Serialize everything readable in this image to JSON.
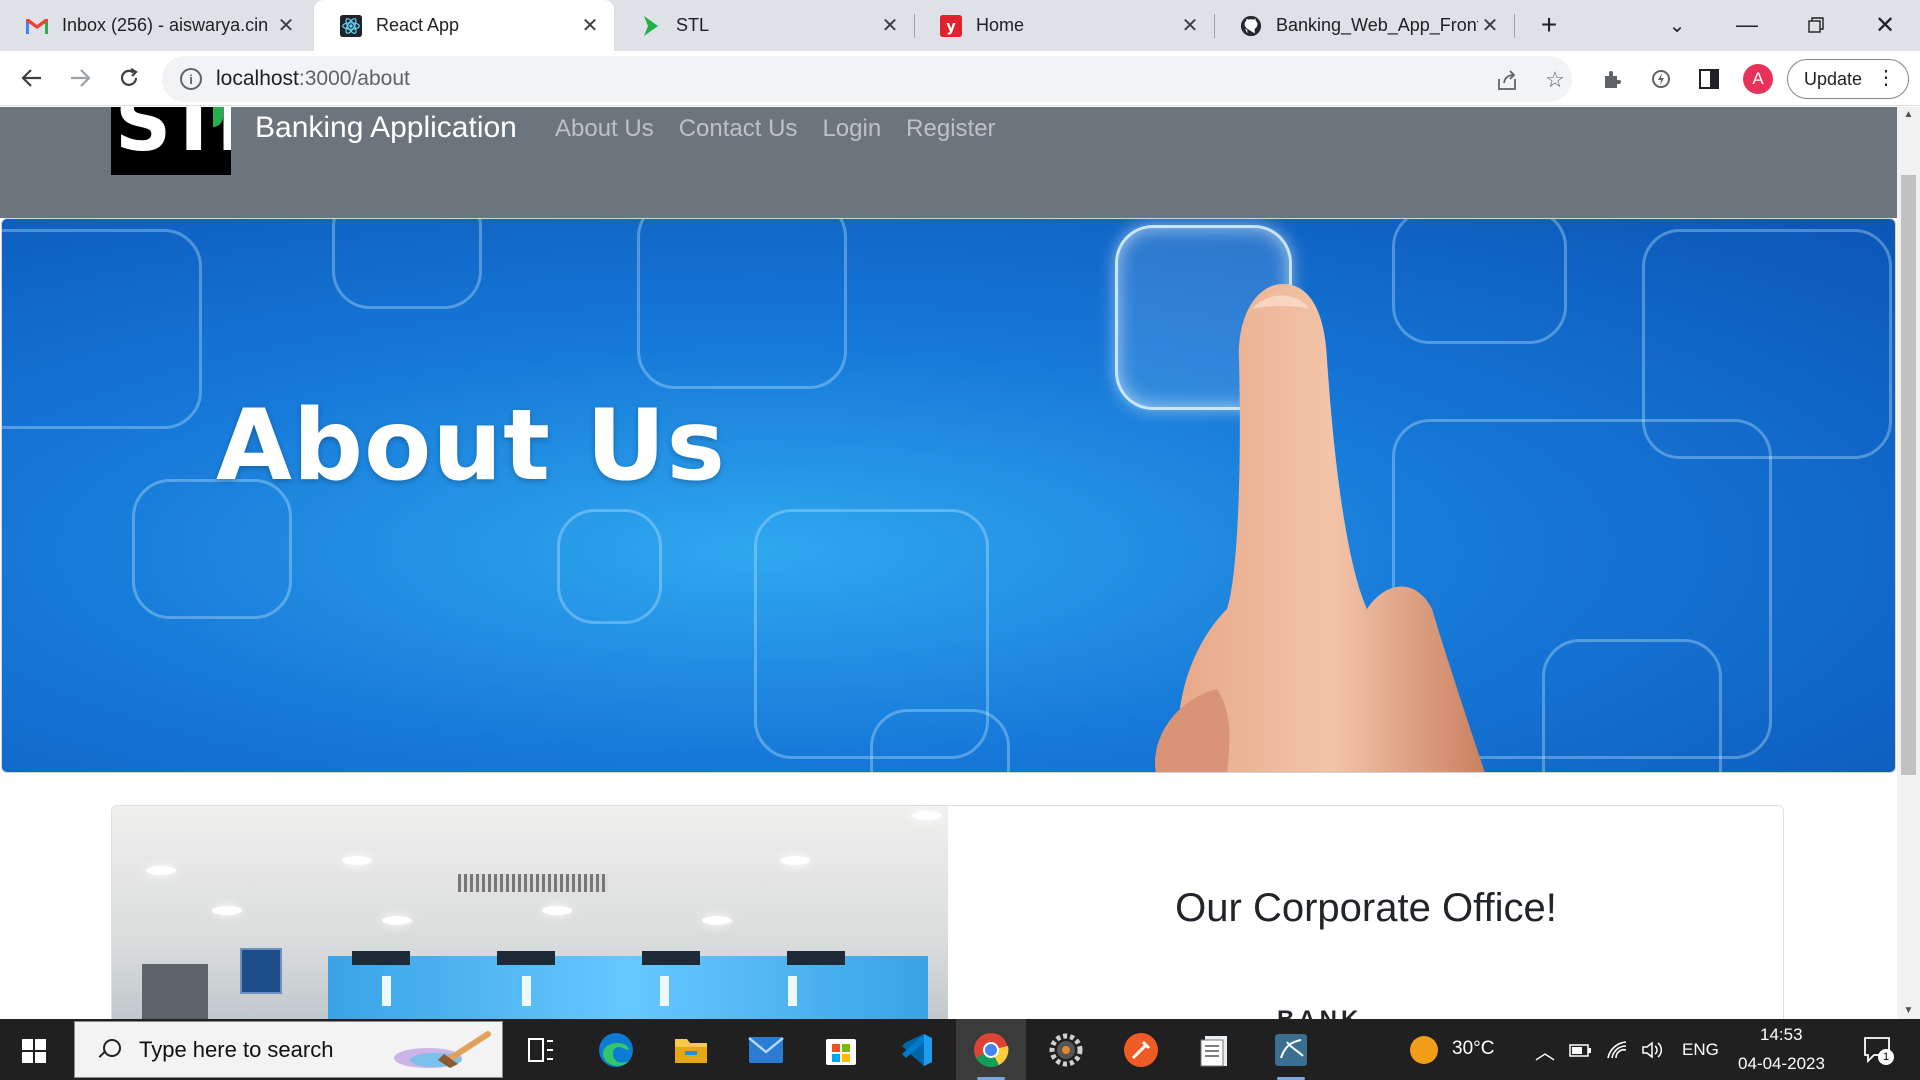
{
  "browser": {
    "tabs": [
      {
        "title": "Inbox (256) - aiswarya.cin",
        "icon": "gmail-icon"
      },
      {
        "title": "React App",
        "icon": "react-icon"
      },
      {
        "title": "STL",
        "icon": "stl-icon"
      },
      {
        "title": "Home",
        "icon": "yahoo-icon"
      },
      {
        "title": "Banking_Web_App_Fronte",
        "icon": "github-icon"
      }
    ],
    "active_tab": "React App",
    "url_host": "localhost",
    "url_path": ":3000/about",
    "profile_initial": "A",
    "update_label": "Update"
  },
  "site": {
    "brand": "Banking Application",
    "logo_text": "STL",
    "nav": [
      "About Us",
      "Contact Us",
      "Login",
      "Register"
    ]
  },
  "hero": {
    "title": "About Us"
  },
  "card": {
    "title": "Our Corporate Office!",
    "subtitle": "BANK"
  },
  "taskbar": {
    "search_placeholder": "Type here to search",
    "weather": "30°C",
    "language": "ENG",
    "time": "14:53",
    "date": "04-04-2023",
    "notification_count": "1"
  },
  "colors": {
    "navbar": "#6c757d",
    "hero_blue": "#1678d8",
    "taskbar": "#202020",
    "tab_strip": "#dee1e6"
  }
}
